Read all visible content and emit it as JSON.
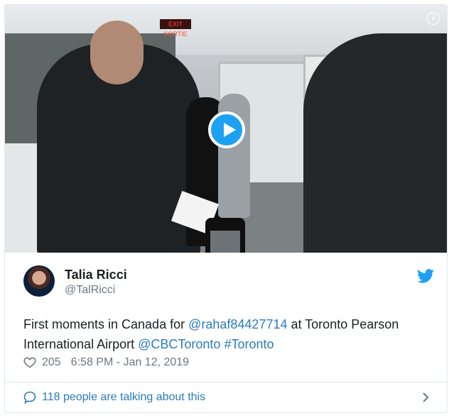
{
  "media": {
    "exit_sign": "EXIT SORTIE",
    "info_label": "i"
  },
  "tweet": {
    "author_name": "Talia Ricci",
    "author_handle": "@TalRicci",
    "text_before": "First moments in Canada for ",
    "mention_1": "@rahaf84427714",
    "text_middle": " at Toronto Pearson International Airport ",
    "mention_2": "@CBCToronto",
    "hashtag": "#Toronto",
    "likes": "205",
    "timestamp": "6:58 PM - Jan 12, 2019"
  },
  "footer": {
    "talking_label": "118 people are talking about this"
  },
  "colors": {
    "link": "#2b7bb9",
    "twitter_blue": "#1da1f2",
    "muted": "#697882"
  },
  "icons": [
    "info-icon",
    "play-icon",
    "twitter-bird-icon",
    "heart-icon",
    "speech-bubble-icon",
    "chevron-right-icon"
  ]
}
